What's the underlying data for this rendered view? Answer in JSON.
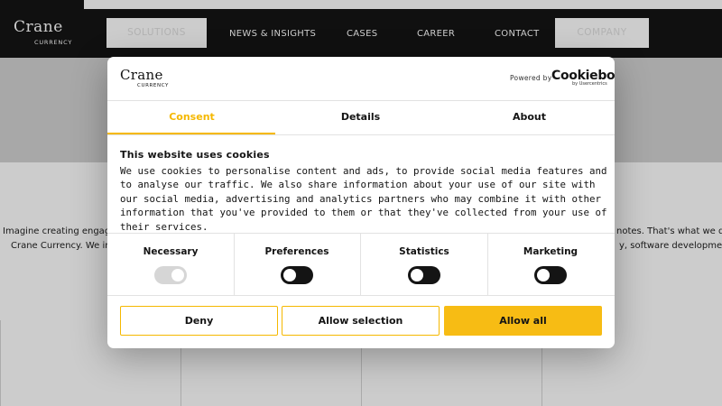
{
  "header": {
    "logo": {
      "name": "Crane",
      "sub": "CURRENCY"
    },
    "nav": {
      "solutions": "SOLUTIONS",
      "news": "NEWS & INSIGHTS",
      "cases": "CASES",
      "career": "CAREER",
      "contact": "CONTACT",
      "company": "COMPANY"
    }
  },
  "background": {
    "left_line1": "Imagine creating engaging c",
    "left_line2": "Crane Currency. We invite",
    "right_line1": "notes. That's what we do at",
    "right_line2": "y, software development,"
  },
  "dialog": {
    "logo": {
      "name": "Crane",
      "sub": "CURRENCY"
    },
    "powered_by": "Powered by",
    "cookiebot": {
      "name": "Cookiebot",
      "sub": "by Usercentrics"
    },
    "tabs": [
      {
        "label": "Consent"
      },
      {
        "label": "Details"
      },
      {
        "label": "About"
      }
    ],
    "title": "This website uses cookies",
    "body": "We use cookies to personalise content and ads, to provide social media features and to analyse our traffic. We also share information about your use of our site with our social media, advertising and analytics partners who may combine it with other information that you've provided to them or that they've collected from your use of their services.",
    "categories": [
      {
        "label": "Necessary",
        "enabled": true,
        "locked": true
      },
      {
        "label": "Preferences",
        "enabled": false
      },
      {
        "label": "Statistics",
        "enabled": false
      },
      {
        "label": "Marketing",
        "enabled": false
      }
    ],
    "buttons": {
      "deny": "Deny",
      "allow_selection": "Allow selection",
      "allow_all": "Allow all"
    }
  },
  "colors": {
    "accent": "#f5b800",
    "dark": "#141414",
    "hero_gray": "#d2d2d2",
    "toggle_off": "#141414",
    "toggle_locked": "#d6d6d6"
  }
}
